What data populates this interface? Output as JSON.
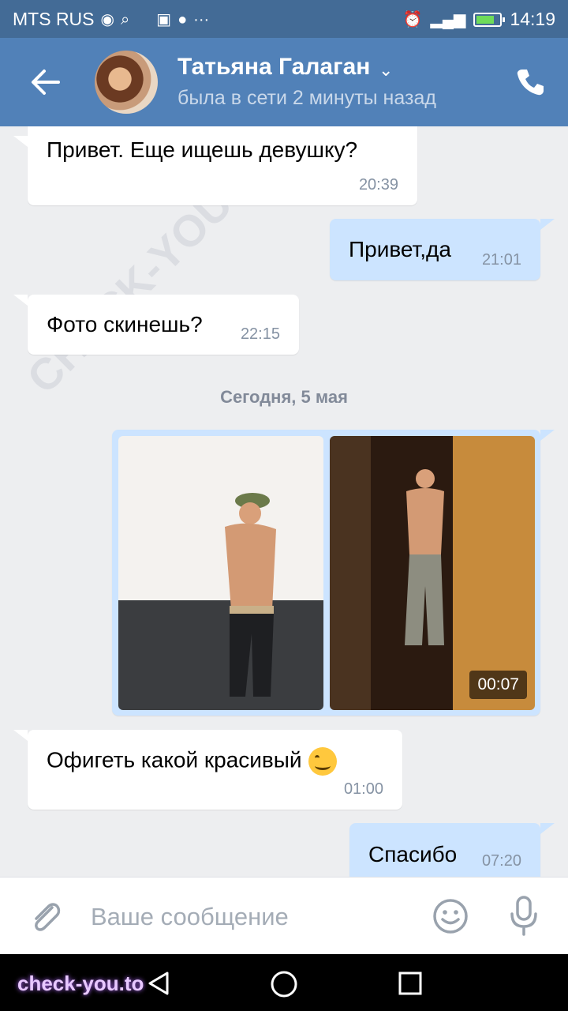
{
  "status_bar": {
    "carrier": "MTS RUS",
    "time": "14:19"
  },
  "header": {
    "name": "Татьяна Галаган",
    "status": "была в сети 2 минуты назад"
  },
  "watermark": {
    "text": "CHECK-YOU.ME"
  },
  "messages": [
    {
      "dir": "in",
      "text": "Привет. Еще ищешь девушку?",
      "time": "20:39"
    },
    {
      "dir": "out",
      "text": "Привет,да",
      "time": "21:01"
    },
    {
      "dir": "in",
      "text": "Фото скинешь?",
      "time": "22:15"
    },
    {
      "dir": "separator",
      "text": "Сегодня, 5 мая"
    },
    {
      "dir": "out",
      "attachment": "photo+video",
      "video_duration": "00:07"
    },
    {
      "dir": "in",
      "text": "Офигеть какой красивый",
      "time": "01:00",
      "emoji": "smiling-face"
    },
    {
      "dir": "out",
      "text": "Спасибо",
      "time": "07:20"
    }
  ],
  "composer": {
    "placeholder": "Ваше сообщение"
  },
  "footer_brand": "check-you.to",
  "colors": {
    "header": "#5181b8",
    "statusbar": "#436b96",
    "incoming": "#ffffff",
    "outgoing": "#cce4ff",
    "background": "#edeef0"
  }
}
